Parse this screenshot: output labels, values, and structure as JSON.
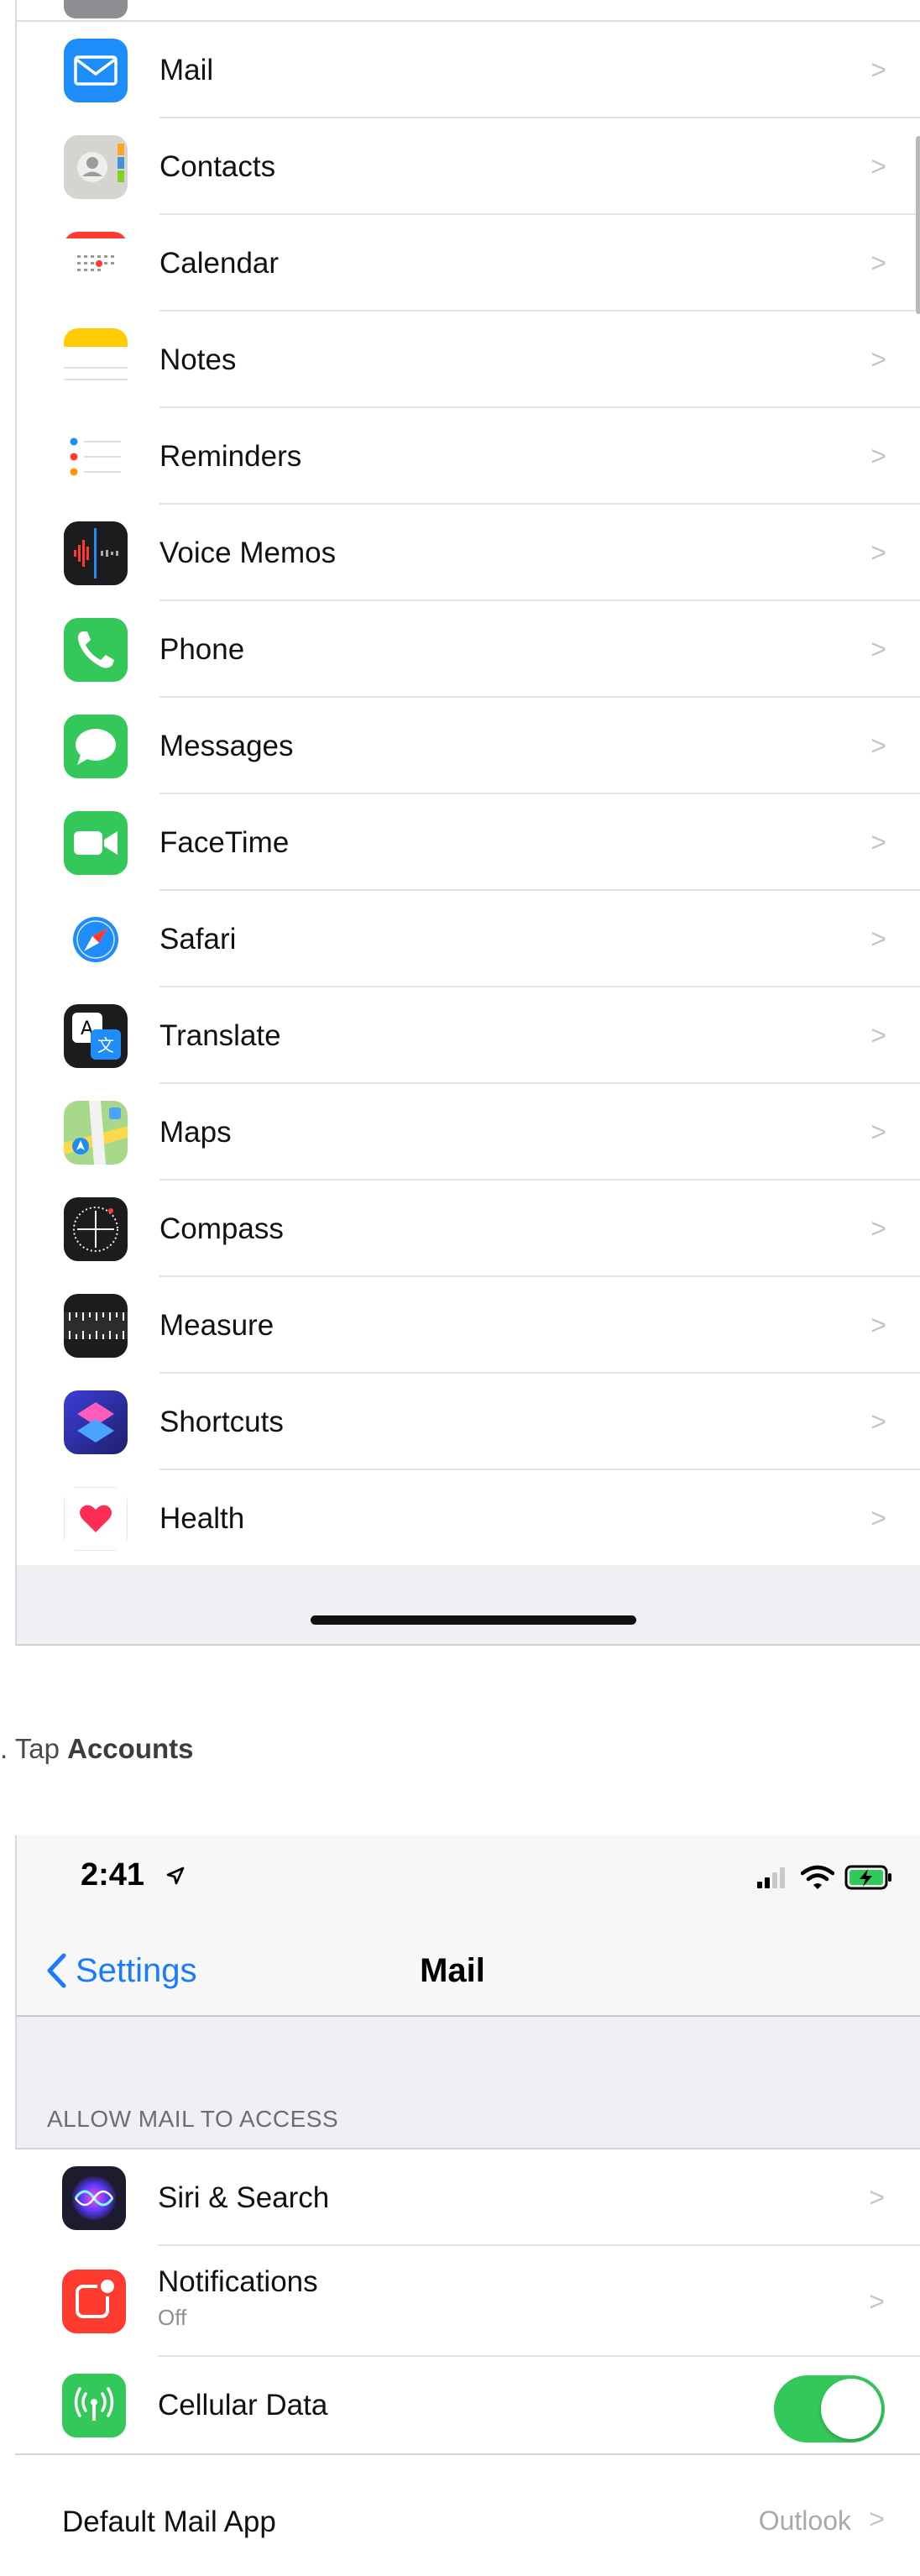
{
  "settings_list": {
    "items": [
      {
        "label": "Mail",
        "icon": "mail-icon"
      },
      {
        "label": "Contacts",
        "icon": "contacts-icon"
      },
      {
        "label": "Calendar",
        "icon": "calendar-icon"
      },
      {
        "label": "Notes",
        "icon": "notes-icon"
      },
      {
        "label": "Reminders",
        "icon": "reminders-icon"
      },
      {
        "label": "Voice Memos",
        "icon": "voice-memos-icon"
      },
      {
        "label": "Phone",
        "icon": "phone-icon"
      },
      {
        "label": "Messages",
        "icon": "messages-icon"
      },
      {
        "label": "FaceTime",
        "icon": "facetime-icon"
      },
      {
        "label": "Safari",
        "icon": "safari-icon"
      },
      {
        "label": "Translate",
        "icon": "translate-icon"
      },
      {
        "label": "Maps",
        "icon": "maps-icon"
      },
      {
        "label": "Compass",
        "icon": "compass-icon"
      },
      {
        "label": "Measure",
        "icon": "measure-icon"
      },
      {
        "label": "Shortcuts",
        "icon": "shortcuts-icon"
      },
      {
        "label": "Health",
        "icon": "health-icon"
      }
    ],
    "chevron": ">"
  },
  "instruction": {
    "prefix": ". Tap ",
    "bold": "Accounts"
  },
  "mail_screen": {
    "status": {
      "time": "2:41"
    },
    "nav": {
      "back_label": "Settings",
      "title": "Mail"
    },
    "section_header": "ALLOW MAIL TO ACCESS",
    "rows": [
      {
        "label": "Siri & Search",
        "icon": "siri-icon"
      },
      {
        "label": "Notifications",
        "sublabel": "Off",
        "icon": "notifications-icon"
      },
      {
        "label": "Cellular Data",
        "icon": "cellular-data-icon",
        "toggle_on": true
      }
    ],
    "default_mail_app": {
      "label": "Default Mail App",
      "value": "Outlook"
    }
  },
  "colors": {
    "ios_blue": "#1a7bff",
    "toggle_green": "#34c759",
    "separator": "#e3e3e6",
    "group_bg": "#efeff4"
  }
}
